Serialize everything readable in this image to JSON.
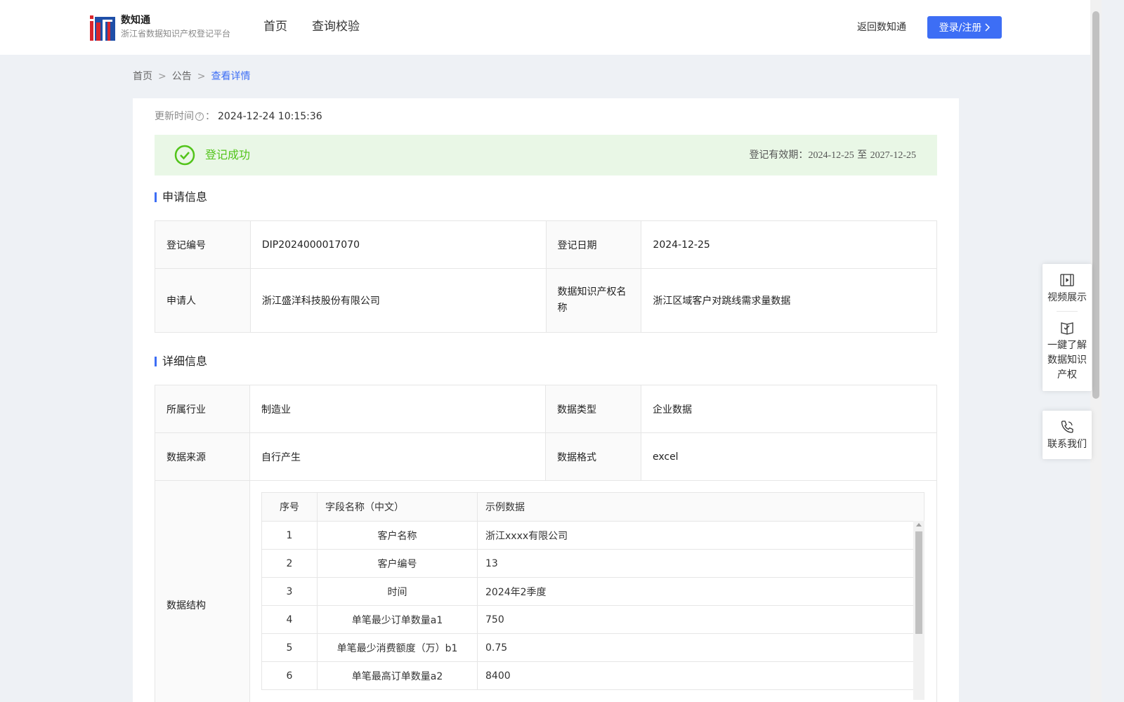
{
  "header": {
    "brand_title": "数知通",
    "brand_subtitle": "浙江省数据知识产权登记平台",
    "nav": [
      "首页",
      "查询校验"
    ],
    "back_link": "返回数知通",
    "login_button": "登录/注册"
  },
  "breadcrumb": {
    "home": "首页",
    "sep": ">",
    "notice": "公告",
    "current": "查看详情"
  },
  "update": {
    "label": "更新时间",
    "colon": "：",
    "value": "2024-12-24 10:15:36"
  },
  "status": {
    "label": "登记成功",
    "validity_label": "登记有效期：",
    "start": "2024-12-25",
    "to": "至",
    "end": "2027-12-25"
  },
  "application": {
    "title": "申请信息",
    "rows": [
      {
        "k1": "登记编号",
        "v1": "DIP2024000017070",
        "k2": "登记日期",
        "v2": "2024-12-25"
      },
      {
        "k1": "申请人",
        "v1": "浙江盛洋科技股份有限公司",
        "k2": "数据知识产权名称",
        "v2": "浙江区域客户对跳线需求量数据"
      }
    ]
  },
  "details": {
    "title": "详细信息",
    "rows": [
      {
        "k1": "所属行业",
        "v1": "制造业",
        "k2": "数据类型",
        "v2": "企业数据"
      },
      {
        "k1": "数据来源",
        "v1": "自行产生",
        "k2": "数据格式",
        "v2": "excel"
      }
    ],
    "structure_label": "数据结构",
    "structure": {
      "headers": [
        "序号",
        "字段名称（中文）",
        "示例数据"
      ],
      "rows": [
        [
          "1",
          "客户名称",
          "浙江xxxx有限公司"
        ],
        [
          "2",
          "客户编号",
          "13"
        ],
        [
          "3",
          "时间",
          "2024年2季度"
        ],
        [
          "4",
          "单笔最少订单数量a1",
          "750"
        ],
        [
          "5",
          "单笔最少消费额度（万）b1",
          "0.75"
        ],
        [
          "6",
          "单笔最高订单数量a2",
          "8400"
        ]
      ]
    }
  },
  "float_panel": {
    "video": "视频展示",
    "learn": "一鍵了解数据知识产权",
    "contact": "联系我们"
  },
  "colors": {
    "primary": "#3d6ef5",
    "success": "#52c41a",
    "success_bg": "#e9f7e6",
    "page_bg": "#eef1f5"
  },
  "icons": [
    "logo-icon",
    "chevron-right-icon",
    "question-icon",
    "check-circle-icon",
    "video-icon",
    "book-icon",
    "phone-icon"
  ]
}
